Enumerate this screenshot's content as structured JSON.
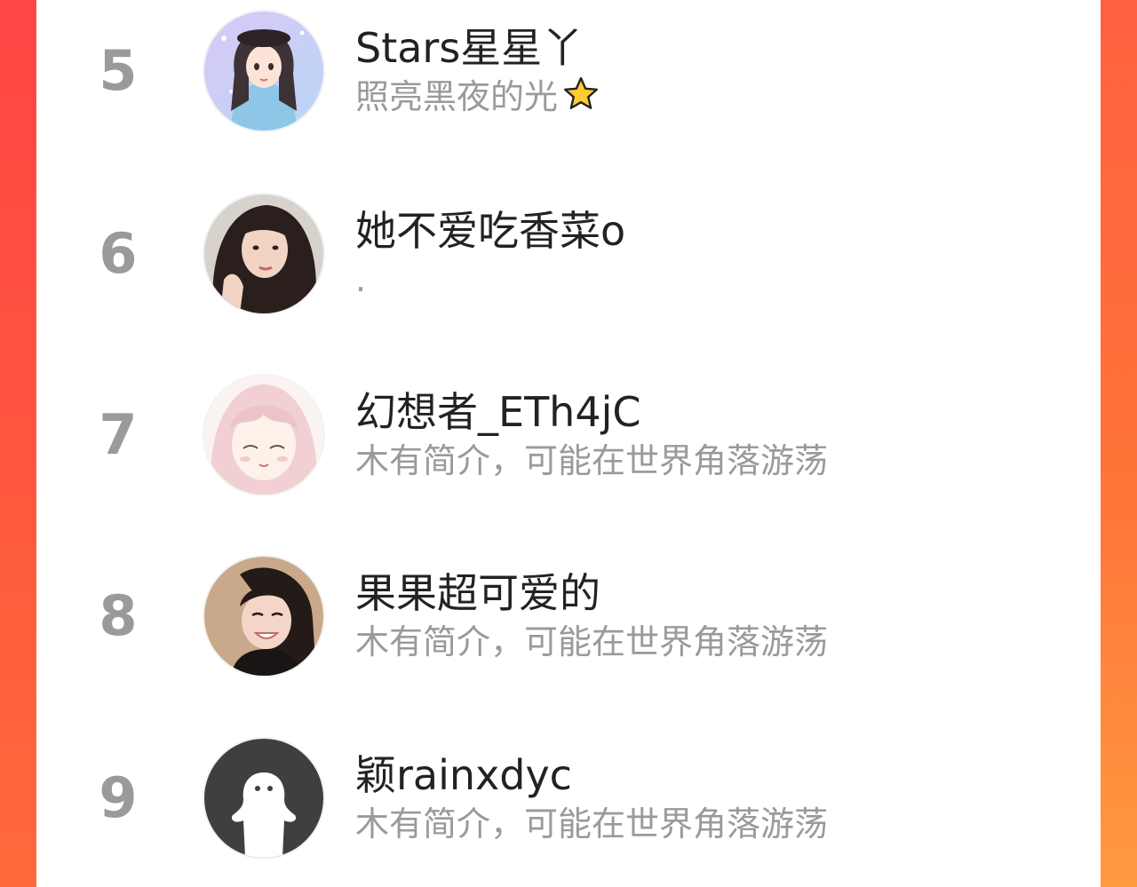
{
  "colors": {
    "accent_left": "#ff4545",
    "accent_right": "#ff7a38",
    "rank_text": "#9a9a9a",
    "name_text": "#222222",
    "bio_text": "#9a9a9a"
  },
  "ranking": {
    "items": [
      {
        "rank": "5",
        "name": "Stars星星丫",
        "bio": "照亮黑夜的光",
        "bio_icon": "star-icon",
        "avatar": "anime-girl-avatar"
      },
      {
        "rank": "6",
        "name": "她不爱吃香菜o",
        "bio": ".",
        "avatar": "photo-girl-avatar"
      },
      {
        "rank": "7",
        "name": "幻想者_ETh4jC",
        "bio": "木有简介，可能在世界角落游荡",
        "avatar": "anime-pink-hair-avatar"
      },
      {
        "rank": "8",
        "name": "果果超可爱的",
        "bio": "木有简介，可能在世界角落游荡",
        "avatar": "photo-smiling-girl-avatar"
      },
      {
        "rank": "9",
        "name": "颖rainxdyc",
        "bio": "木有简介，可能在世界角落游荡",
        "avatar": "default-user-avatar"
      }
    ]
  }
}
